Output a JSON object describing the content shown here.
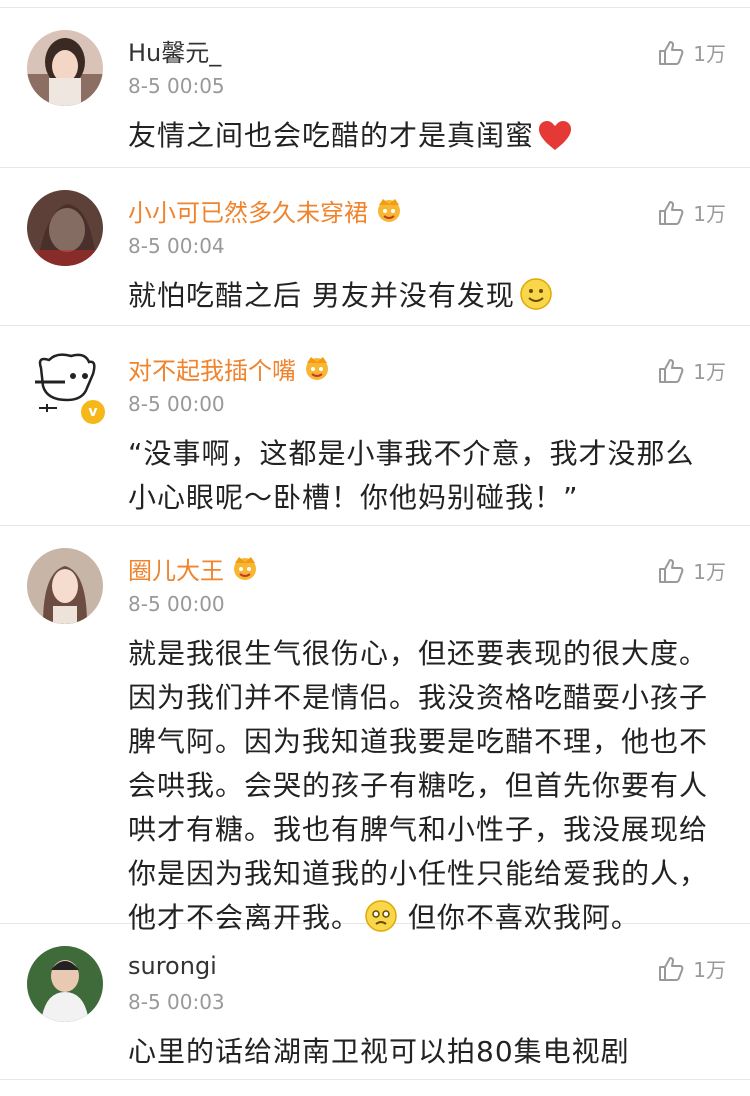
{
  "comments": [
    {
      "user": "Hu馨元_",
      "vip": false,
      "time": "8-5 00:05",
      "likes": "1万",
      "text": "友情之间也会吃醋的才是真闺蜜",
      "emoji": "red-heart-emoji"
    },
    {
      "user": "小小可已然多久未穿裙",
      "vip": true,
      "time": "8-5 00:04",
      "likes": "1万",
      "text": "就怕吃醋之后 男友并没有发现",
      "emoji": "smile-emoji"
    },
    {
      "user": "对不起我插个嘴",
      "vip": true,
      "verified": true,
      "time": "8-5 00:00",
      "likes": "1万",
      "text": "“没事啊，这都是小事我不介意，我才没那么小心眼呢～卧槽！你他妈别碰我！”"
    },
    {
      "user": "圈儿大王",
      "vip": true,
      "time": "8-5 00:00",
      "likes": "1万",
      "text_before": "就是我很生气很伤心，但还要表现的很大度。因为我们并不是情侣。我没资格吃醋耍小孩子脾气阿。因为我知道我要是吃醋不理，他也不会哄我。会哭的孩子有糖吃，但首先你要有人哄才有糖。我也有脾气和小性子，我没展现给你是因为我知道我的小任性只能给爱我的人，他才不会离开我。",
      "text_after": " 但你不喜欢我阿。",
      "emoji": "sad-emoji"
    },
    {
      "user": "surongi",
      "vip": false,
      "time": "8-5 00:03",
      "likes": "1万",
      "text": "心里的话给湖南卫视可以拍80集电视剧"
    }
  ],
  "colors": {
    "vip_name": "#f0832c",
    "normal_name": "#333333",
    "meta": "#999999",
    "divider": "#e6e6e6",
    "verified_badge": "#f6b818"
  }
}
